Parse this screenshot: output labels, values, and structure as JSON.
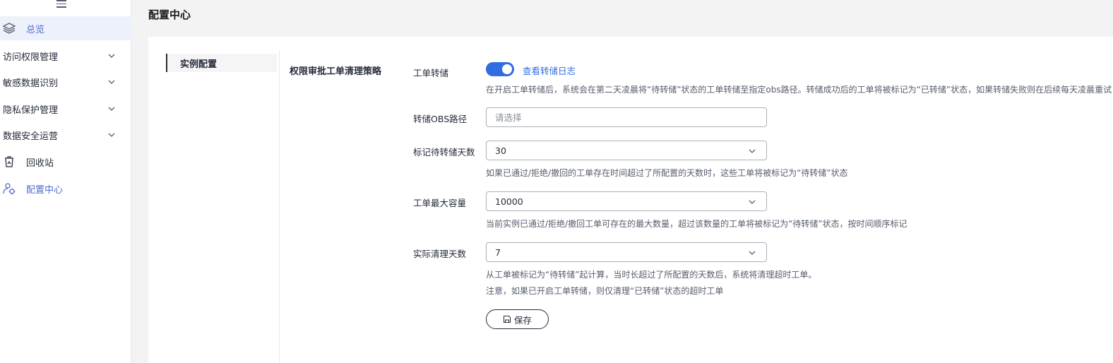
{
  "sidebar": {
    "items": [
      {
        "label": "总览"
      },
      {
        "label": "访问权限管理"
      },
      {
        "label": "敏感数据识别"
      },
      {
        "label": "隐私保护管理"
      },
      {
        "label": "数据安全运营"
      },
      {
        "label": "回收站"
      },
      {
        "label": "配置中心"
      }
    ]
  },
  "page": {
    "title": "配置中心"
  },
  "tabs": [
    {
      "label": "实例配置"
    }
  ],
  "section": {
    "title": "权限审批工单清理策略"
  },
  "form": {
    "dump": {
      "label": "工单转储",
      "enabled": true,
      "link": "查看转储日志",
      "hint": "在开启工单转储后，系统会在第二天凌晨将“待转储”状态的工单转储至指定obs路径。转储成功后的工单将被标记为“已转储”状态，如果转储失败则在后续每天凌晨重试"
    },
    "obs_path": {
      "label": "转储OBS路径",
      "placeholder": "请选择"
    },
    "mark_days": {
      "label": "标记待转储天数",
      "value": "30",
      "hint": "如果已通过/拒绝/撤回的工单存在时间超过了所配置的天数时，这些工单将被标记为“待转储”状态"
    },
    "max_capacity": {
      "label": "工单最大容量",
      "value": "10000",
      "hint": "当前实例已通过/拒绝/撤回工单可存在的最大数量，超过该数量的工单将被标记为“待转储”状态，按时间顺序标记"
    },
    "clean_days": {
      "label": "实际清理天数",
      "value": "7",
      "hint1": "从工单被标记为“待转储”起计算，当时长超过了所配置的天数后，系统将清理超时工单。",
      "hint2": "注意，如果已开启工单转储，则仅清理“已转储”状态的超时工单"
    },
    "save_label": "保存"
  },
  "colors": {
    "accent": "#2f6de1",
    "sidebar_active_text": "#526ecc"
  }
}
